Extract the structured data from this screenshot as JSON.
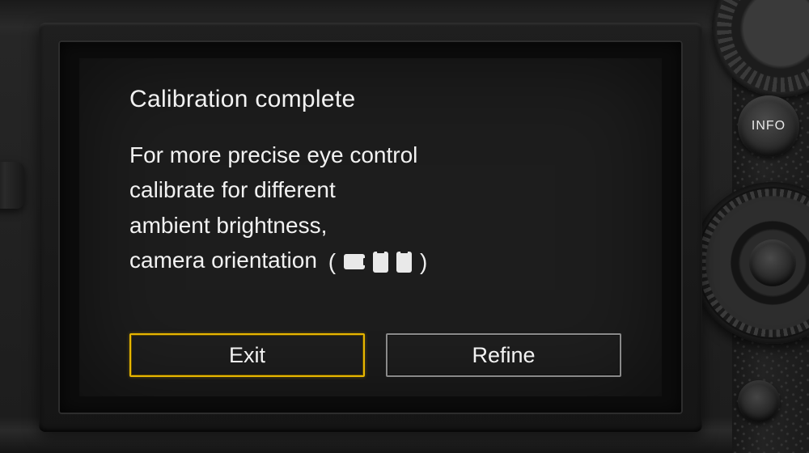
{
  "hardware": {
    "info_button_label": "INFO"
  },
  "screen": {
    "title": "Calibration complete",
    "body": {
      "line1": "For more precise eye control",
      "line2": "calibrate for different",
      "line3": "ambient brightness,",
      "line4_prefix": "camera orientation"
    },
    "orientation_paren_open": "(",
    "orientation_paren_close": ")",
    "orientation_icons": [
      "landscape",
      "portrait-left",
      "portrait-right"
    ],
    "buttons": {
      "exit": "Exit",
      "refine": "Refine",
      "selected": "exit"
    }
  }
}
